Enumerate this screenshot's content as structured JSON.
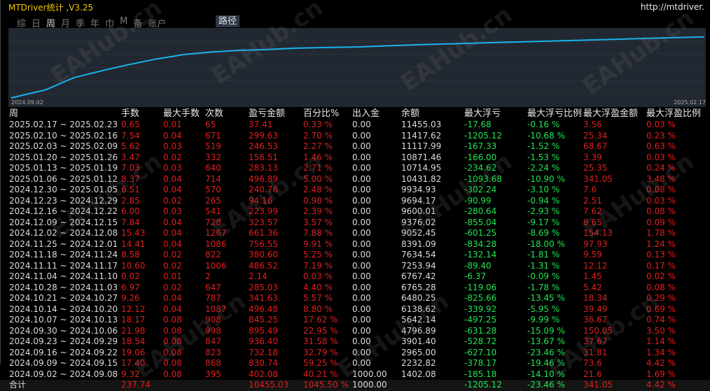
{
  "app": {
    "title": "MTDriver统计 ,V3.25",
    "url": "http://mtdriver."
  },
  "tabs": [
    "综",
    "日",
    "周",
    "月",
    "季",
    "年",
    "巾",
    "M",
    "备",
    "账户"
  ],
  "route_label": "路径",
  "chart": {
    "start_date": "2024.09.02",
    "end_date": "2025.02.17",
    "line_color": "#1ab2f0",
    "curve": [
      [
        0,
        0
      ],
      [
        0.05,
        0.13
      ],
      [
        0.09,
        0.32
      ],
      [
        0.13,
        0.43
      ],
      [
        0.17,
        0.53
      ],
      [
        0.21,
        0.62
      ],
      [
        0.25,
        0.69
      ],
      [
        0.29,
        0.73
      ],
      [
        0.33,
        0.755
      ],
      [
        0.37,
        0.77
      ],
      [
        0.41,
        0.79
      ],
      [
        0.45,
        0.8
      ],
      [
        0.5,
        0.81
      ],
      [
        0.55,
        0.83
      ],
      [
        0.6,
        0.85
      ],
      [
        0.65,
        0.865
      ],
      [
        0.7,
        0.88
      ],
      [
        0.75,
        0.895
      ],
      [
        0.8,
        0.91
      ],
      [
        0.85,
        0.925
      ],
      [
        0.9,
        0.94
      ],
      [
        0.95,
        0.955
      ],
      [
        1,
        0.97
      ]
    ]
  },
  "table": {
    "headers": [
      "周",
      "手数",
      "最大手数",
      "次数",
      "盈亏金额",
      "百分比%",
      "出入金",
      "余额",
      "最大浮亏",
      "最大浮亏比例",
      "最大浮盈金额",
      "最大浮盈比例"
    ],
    "rows": [
      [
        "2025.02.17 ~ 2025.02.23",
        "0.65",
        "0.01",
        "65",
        "37.41",
        "0.33 %",
        "0.00",
        "11455.03",
        "-17.68",
        "-0.16 %",
        "3.56",
        "0.03 %"
      ],
      [
        "2025.02.10 ~ 2025.02.16",
        "7.54",
        "0.04",
        "671",
        "299.63",
        "2.70 %",
        "0.00",
        "11417.62",
        "-1205.12",
        "-10.68 %",
        "25.34",
        "0.23 %"
      ],
      [
        "2025.02.03 ~ 2025.02.09",
        "5.62",
        "0.03",
        "519",
        "246.53",
        "2.27 %",
        "0.00",
        "11117.99",
        "-167.33",
        "-1.52 %",
        "68.67",
        "0.63 %"
      ],
      [
        "2025.01.20 ~ 2025.01.26",
        "3.47",
        "0.02",
        "332",
        "156.51",
        "1.46 %",
        "0.00",
        "10871.46",
        "-166.00",
        "-1.53 %",
        "3.39",
        "0.03 %"
      ],
      [
        "2025.01.13 ~ 2025.01.19",
        "7.03",
        "0.03",
        "640",
        "283.13",
        "2.71 %",
        "0.00",
        "10714.95",
        "-234.62",
        "-2.24 %",
        "25.35",
        "0.24 %"
      ],
      [
        "2025.01.06 ~ 2025.01.12",
        "8.37",
        "0.04",
        "714",
        "496.89",
        "5.00 %",
        "0.00",
        "10431.82",
        "-1093.68",
        "-10.90 %",
        "341.05",
        "3.48 %"
      ],
      [
        "2024.12.30 ~ 2025.01.05",
        "6.51",
        "0.04",
        "570",
        "240.76",
        "2.48 %",
        "0.00",
        "9934.93",
        "-302.24",
        "-3.10 %",
        "7.6",
        "0.08 %"
      ],
      [
        "2024.12.23 ~ 2024.12.29",
        "2.85",
        "0.02",
        "265",
        "94.16",
        "0.98 %",
        "0.00",
        "9694.17",
        "-90.99",
        "-0.94 %",
        "2.51",
        "0.03 %"
      ],
      [
        "2024.12.16 ~ 2024.12.22",
        "6.00",
        "0.03",
        "541",
        "223.99",
        "2.39 %",
        "0.00",
        "9600.01",
        "-280.64",
        "-2.93 %",
        "7.62",
        "0.08 %"
      ],
      [
        "2024.12.09 ~ 2024.12.15",
        "7.84",
        "0.04",
        "728",
        "323.57",
        "3.57 %",
        "0.00",
        "9376.02",
        "-855.04",
        "-9.17 %",
        "8.65",
        "0.09 %"
      ],
      [
        "2024.12.02 ~ 2024.12.08",
        "15.43",
        "0.04",
        "1267",
        "661.36",
        "7.88 %",
        "0.00",
        "9052.45",
        "-601.25",
        "-8.69 %",
        "154.13",
        "1.78 %"
      ],
      [
        "2024.11.25 ~ 2024.12.01",
        "14.41",
        "0.04",
        "1086",
        "756.55",
        "9.91 %",
        "0.00",
        "8391.09",
        "-834.28",
        "-18.00 %",
        "97.93",
        "1.24 %"
      ],
      [
        "2024.11.18 ~ 2024.11.24",
        "8.58",
        "0.02",
        "822",
        "380.60",
        "5.25 %",
        "0.00",
        "7634.54",
        "-132.14",
        "-1.81 %",
        "9.59",
        "0.13 %"
      ],
      [
        "2024.11.11 ~ 2024.11.17",
        "10.60",
        "0.02",
        "1006",
        "486.52",
        "7.19 %",
        "0.00",
        "7253.94",
        "-89.40",
        "-1.31 %",
        "12.12",
        "0.17 %"
      ],
      [
        "2024.11.04 ~ 2024.11.10",
        "0.02",
        "0.01",
        "2",
        "2.14",
        "0.03 %",
        "0.00",
        "6767.42",
        "-6.37",
        "-0.09 %",
        "1.45",
        "0.02 %"
      ],
      [
        "2024.10.28 ~ 2024.11.03",
        "6.97",
        "0.02",
        "647",
        "285.03",
        "4.40 %",
        "0.00",
        "6765.28",
        "-119.06",
        "-1.78 %",
        "5.42",
        "0.08 %"
      ],
      [
        "2024.10.21 ~ 2024.10.27",
        "9.26",
        "0.04",
        "787",
        "341.63",
        "5.57 %",
        "0.00",
        "6480.25",
        "-825.66",
        "-13.45 %",
        "18.34",
        "0.29 %"
      ],
      [
        "2024.10.14 ~ 2024.10.20",
        "12.12",
        "0.04",
        "1087",
        "496.48",
        "8.80 %",
        "0.00",
        "6138.62",
        "-339.92",
        "-5.95 %",
        "39.49",
        "0.69 %"
      ],
      [
        "2024.10.07 ~ 2024.10.13",
        "18.17",
        "0.08",
        "908",
        "845.25",
        "17.62 %",
        "0.00",
        "5642.14",
        "-497.25",
        "-9.99 %",
        "36.67",
        "0.74 %"
      ],
      [
        "2024.09.30 ~ 2024.10.06",
        "21.98",
        "0.08",
        "998",
        "895.49",
        "22.95 %",
        "0.00",
        "4796.89",
        "-631.28",
        "-15.09 %",
        "150.05",
        "3.50 %"
      ],
      [
        "2024.09.23 ~ 2024.09.29",
        "18.54",
        "0.08",
        "847",
        "936.40",
        "31.58 %",
        "0.00",
        "3901.40",
        "-528.72",
        "-13.67 %",
        "37.67",
        "1.14 %"
      ],
      [
        "2024.09.16 ~ 2024.09.22",
        "19.06",
        "0.08",
        "823",
        "732.18",
        "32.79 %",
        "0.00",
        "2965.00",
        "-627.10",
        "-23.46 %",
        "31.81",
        "1.34 %"
      ],
      [
        "2024.09.09 ~ 2024.09.15",
        "17.40",
        "0.08",
        "868",
        "830.74",
        "59.25 %",
        "0.00",
        "2232.82",
        "-378.17",
        "-19.46 %",
        "73.6",
        "4.42 %"
      ],
      [
        "2024.09.02 ~ 2024.09.08",
        "9.32",
        "0.08",
        "395",
        "402.08",
        "40.21 %",
        "1000.00",
        "1402.08",
        "-185.18",
        "-14.10 %",
        "21.6",
        "1.69 %"
      ]
    ],
    "total": [
      "合计",
      "237.74",
      "",
      "",
      "10455.03",
      "1045.50 %",
      "1000.00",
      "",
      "-1205.12",
      "-23.46 %",
      "341.05",
      "4.42 %"
    ]
  },
  "watermark": "EAHub.cn"
}
